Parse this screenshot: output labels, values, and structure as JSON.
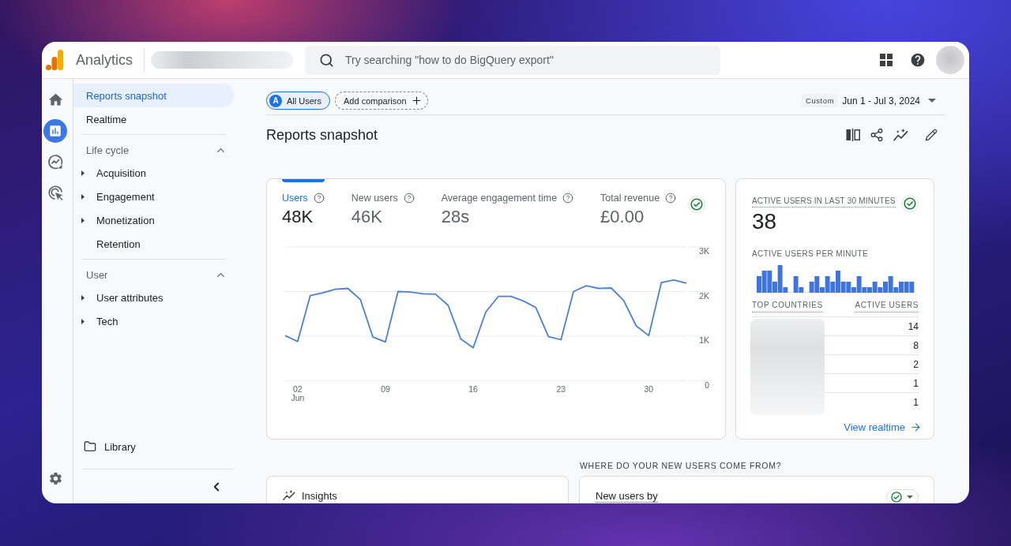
{
  "header": {
    "app_name": "Analytics",
    "search": {
      "placeholder": "Try searching \"how to do BigQuery export\""
    }
  },
  "rail": {
    "items": [
      {
        "kind": "home",
        "selected": false
      },
      {
        "kind": "reports",
        "selected": true
      },
      {
        "kind": "explore",
        "selected": false
      },
      {
        "kind": "advertising",
        "selected": false
      }
    ]
  },
  "nav": {
    "items": [
      {
        "label": "Reports snapshot",
        "selected": true
      },
      {
        "label": "Realtime",
        "selected": false
      }
    ],
    "sections": [
      {
        "title": "Life cycle",
        "expanded": true,
        "children": [
          {
            "label": "Acquisition",
            "kind": "group",
            "selected": false
          },
          {
            "label": "Engagement",
            "kind": "group",
            "selected": false
          },
          {
            "label": "Monetization",
            "kind": "group",
            "selected": false
          },
          {
            "label": "Retention",
            "kind": "page",
            "selected": false
          }
        ]
      },
      {
        "title": "User",
        "expanded": true,
        "children": [
          {
            "label": "User attributes",
            "kind": "group",
            "selected": false
          },
          {
            "label": "Tech",
            "kind": "group",
            "selected": false
          }
        ]
      }
    ],
    "library": "Library"
  },
  "toolbar": {
    "comparisons": [
      {
        "badge": "A",
        "label": "All Users"
      }
    ],
    "add_comparison": "Add comparison",
    "date_range": {
      "preset": "Custom",
      "range": "Jun 1 - Jul 3, 2024"
    }
  },
  "page_title": "Reports snapshot",
  "overview_card": {
    "metrics": [
      {
        "label": "Users",
        "value": "48K",
        "selected": true
      },
      {
        "label": "New users",
        "value": "46K",
        "selected": false
      },
      {
        "label": "Average engagement time",
        "value": "28s",
        "selected": false
      },
      {
        "label": "Total revenue",
        "value": "£0.00",
        "selected": false
      }
    ],
    "chart_data": {
      "type": "line",
      "x": [
        1,
        2,
        3,
        4,
        5,
        6,
        7,
        8,
        9,
        10,
        11,
        12,
        13,
        14,
        15,
        16,
        17,
        18,
        19,
        20,
        21,
        22,
        23,
        24,
        25,
        26,
        27,
        28,
        29,
        30,
        31,
        32,
        33
      ],
      "xlim": [
        1,
        33
      ],
      "ylim": [
        0,
        3000
      ],
      "xticks": [
        {
          "value": 2,
          "label": "02\nJun"
        },
        {
          "value": 9,
          "label": "09"
        },
        {
          "value": 16,
          "label": "16"
        },
        {
          "value": 23,
          "label": "23"
        },
        {
          "value": 30,
          "label": "30"
        }
      ],
      "yticks": [
        {
          "value": 0,
          "label": "0"
        },
        {
          "value": 1000,
          "label": "1K"
        },
        {
          "value": 2000,
          "label": "2K"
        },
        {
          "value": 3000,
          "label": "3K"
        }
      ],
      "series": [
        {
          "color": "#4a7fdc",
          "values": [
            1010,
            880,
            1910,
            1970,
            2050,
            2070,
            1820,
            980,
            870,
            2000,
            1990,
            1950,
            1940,
            1690,
            940,
            740,
            1540,
            1890,
            1890,
            1790,
            1640,
            990,
            920,
            2000,
            2130,
            2070,
            2080,
            1800,
            1230,
            1010,
            2200,
            2260,
            2190
          ]
        }
      ]
    }
  },
  "realtime_card": {
    "title": "ACTIVE USERS IN LAST 30 MINUTES",
    "value": "38",
    "per_minute_label": "ACTIVE USERS PER MINUTE",
    "table": {
      "columns": [
        "TOP COUNTRIES",
        "ACTIVE USERS"
      ],
      "rows": [
        {
          "active_users": "14"
        },
        {
          "active_users": "8"
        },
        {
          "active_users": "2"
        },
        {
          "active_users": "1"
        },
        {
          "active_users": "1"
        }
      ]
    },
    "link": "View realtime"
  },
  "bottom": {
    "heading": "WHERE DO YOUR NEW USERS COME FROM?",
    "insights_card": {
      "title": "Insights"
    },
    "new_users_card": {
      "title": "New users by"
    }
  }
}
